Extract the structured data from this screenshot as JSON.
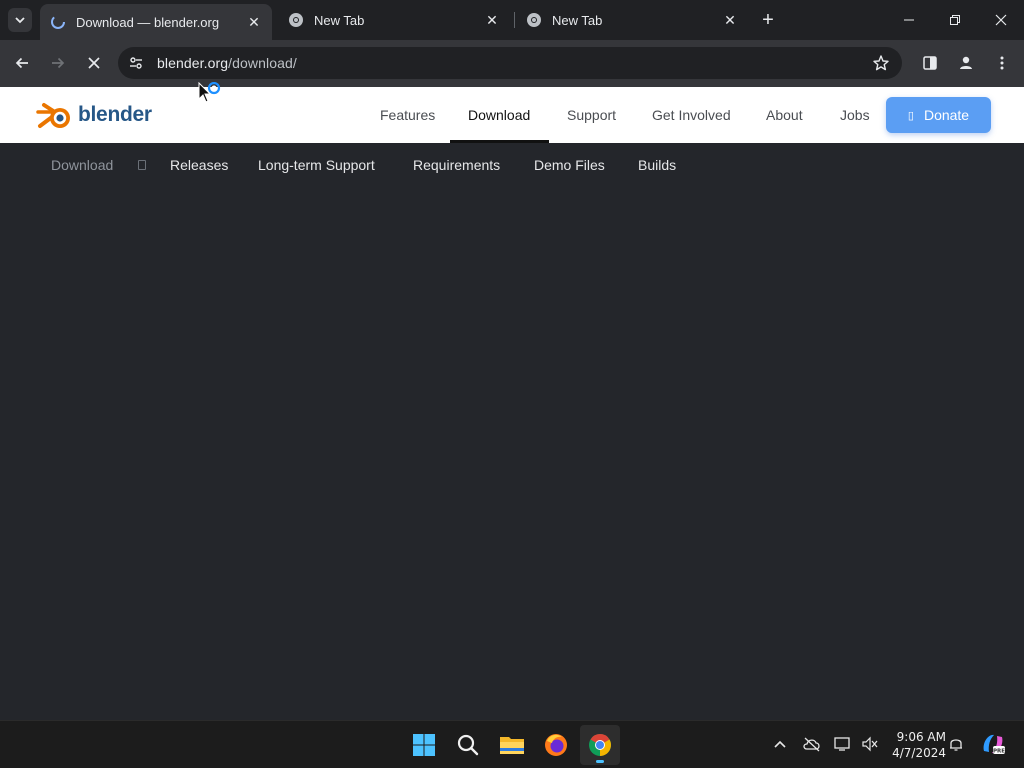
{
  "browser": {
    "tabs": [
      {
        "title": "Download — blender.org",
        "active": true
      },
      {
        "title": "New Tab",
        "active": false
      },
      {
        "title": "New Tab",
        "active": false
      }
    ],
    "address": {
      "host": "blender.org",
      "path": "/download/"
    }
  },
  "site": {
    "logo_text": "blender",
    "nav": [
      {
        "label": "Features"
      },
      {
        "label": "Download"
      },
      {
        "label": "Support"
      },
      {
        "label": "Get Involved"
      },
      {
        "label": "About"
      },
      {
        "label": "Jobs"
      }
    ],
    "donate_label": "Donate",
    "subnav": [
      {
        "label": "Download"
      },
      {
        "label": "Releases"
      },
      {
        "label": "Long-term Support"
      },
      {
        "label": "Requirements"
      },
      {
        "label": "Demo Files"
      },
      {
        "label": "Builds"
      }
    ]
  },
  "taskbar": {
    "time": "9:06 AM",
    "date": "4/7/2024"
  },
  "colors": {
    "page_bg": "#24262b",
    "donate": "#5b9ef3",
    "blender_orange": "#ea7600",
    "blender_blue": "#265787"
  }
}
